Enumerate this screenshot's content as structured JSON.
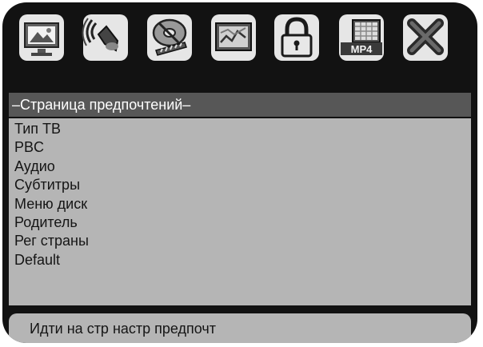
{
  "toolbar": {
    "items": [
      {
        "icon": "general-setup-icon"
      },
      {
        "icon": "audio-setup-icon"
      },
      {
        "icon": "video-setup-icon"
      },
      {
        "icon": "speaker-setup-icon"
      },
      {
        "icon": "password-lock-icon"
      },
      {
        "icon": "mp4-setup-icon",
        "label": "MP4"
      },
      {
        "icon": "exit-icon"
      }
    ]
  },
  "header": {
    "title": "–Страница предпочтений–"
  },
  "menu": {
    "items": [
      {
        "label": "Тип ТВ"
      },
      {
        "label": "PBC"
      },
      {
        "label": "Аудио"
      },
      {
        "label": "Субтитры"
      },
      {
        "label": "Меню диск"
      },
      {
        "label": "Родитель"
      },
      {
        "label": "Рег страны"
      },
      {
        "label": "Default"
      }
    ]
  },
  "status": {
    "text": "Идти на стр настр предпочт"
  },
  "colors": {
    "frame": "#121212",
    "header": "#575757",
    "panel": "#b5b5b5",
    "text_dark": "#151515",
    "text_light": "#ffffff"
  }
}
